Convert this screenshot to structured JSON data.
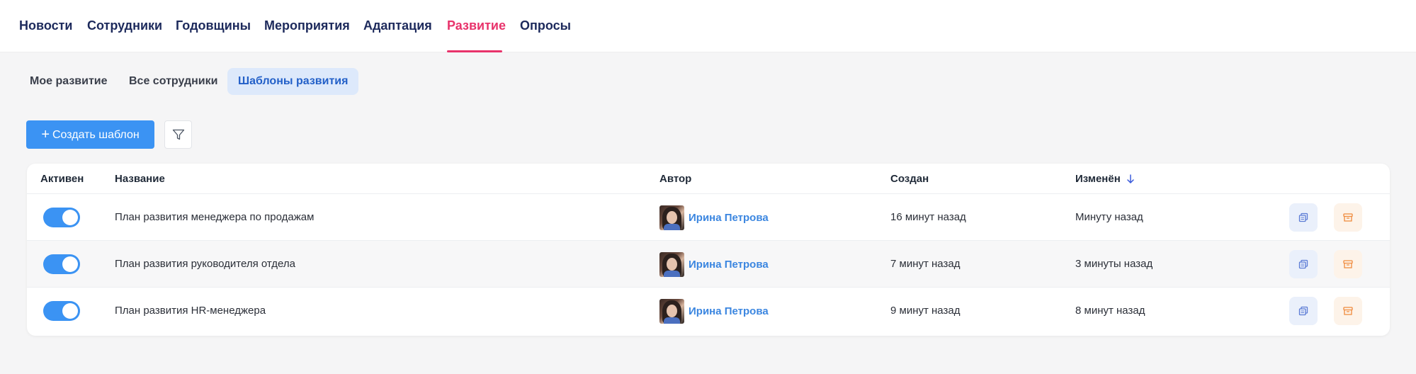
{
  "topnav": {
    "items": [
      "Новости",
      "Сотрудники",
      "Годовщины",
      "Мероприятия",
      "Адаптация",
      "Развитие",
      "Опросы"
    ],
    "active": "Развитие"
  },
  "subtabs": {
    "items": [
      "Мое развитие",
      "Все сотрудники",
      "Шаблоны развития"
    ],
    "active": "Шаблоны развития"
  },
  "toolbar": {
    "create_label": "Создать шаблон"
  },
  "table": {
    "headers": {
      "active": "Активен",
      "name": "Название",
      "author": "Автор",
      "created": "Создан",
      "modified": "Изменён"
    },
    "rows": [
      {
        "active": true,
        "name": "План развития менеджера по продажам",
        "author": "Ирина Петрова",
        "created": "16 минут назад",
        "modified": "Минуту назад"
      },
      {
        "active": true,
        "name": "План развития руководителя отдела",
        "author": "Ирина Петрова",
        "created": "7 минут назад",
        "modified": "3 минуты назад"
      },
      {
        "active": true,
        "name": "План развития HR-менеджера",
        "author": "Ирина Петрова",
        "created": "9 минут назад",
        "modified": "8 минут назад"
      }
    ]
  },
  "colors": {
    "accent": "#3b93f3",
    "active_tab": "#e8336b",
    "nav_text": "#1d2a5c",
    "author_link": "#3b86e0",
    "copy_icon": "#5b7bd5",
    "archive_icon": "#f08a3c"
  },
  "icons": {
    "filter": "filter-icon",
    "sort": "arrow-down-icon",
    "copy": "copy-icon",
    "archive": "archive-icon"
  }
}
